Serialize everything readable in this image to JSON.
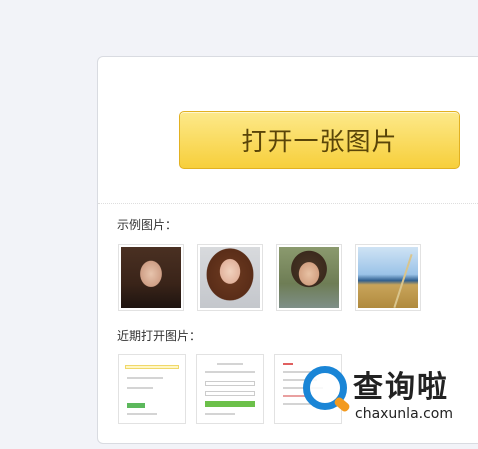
{
  "open_button": {
    "label": "打开一张图片"
  },
  "examples": {
    "label": "示例图片：",
    "items": [
      {
        "name": "woman-brown-hair-photo"
      },
      {
        "name": "woman-portrait-photo"
      },
      {
        "name": "child-portrait-photo"
      },
      {
        "name": "grass-sea-photo"
      }
    ]
  },
  "recent": {
    "label": "近期打开图片：",
    "items": [
      {
        "name": "recent-screenshot-1"
      },
      {
        "name": "recent-screenshot-2"
      },
      {
        "name": "recent-screenshot-3"
      }
    ]
  },
  "watermark": {
    "title": "查询啦",
    "url": "chaxunla.com"
  },
  "colors": {
    "button_top": "#fde98a",
    "button_bottom": "#f7cf3b",
    "watermark_blue": "#1a85d6",
    "watermark_orange": "#f39a1e"
  }
}
